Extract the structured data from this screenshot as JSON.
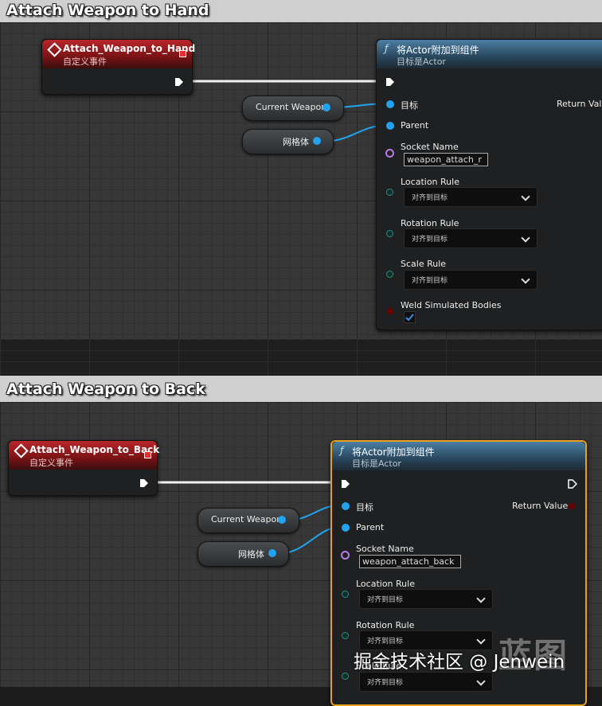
{
  "top": {
    "comment_title": "Attach Weapon to Hand",
    "event": {
      "title": "Attach_Weapon_to_Hand",
      "subtitle": "自定义事件"
    },
    "function": {
      "f_glyph": "ƒ",
      "title": "将Actor附加到组件",
      "subtitle": "目标是Actor",
      "return_label": "Return Valu",
      "pins": {
        "target": "目标",
        "parent": "Parent",
        "socket_name": "Socket Name",
        "socket_value": "weapon_attach_r",
        "location_rule": "Location Rule",
        "location_value": "对齐到目标",
        "rotation_rule": "Rotation Rule",
        "rotation_value": "对齐到目标",
        "scale_rule": "Scale Rule",
        "scale_value": "对齐到目标",
        "weld": "Weld Simulated Bodies"
      }
    },
    "vars": {
      "current_weapon": "Current Weapon",
      "mesh": "网格体"
    }
  },
  "bottom": {
    "comment_title": "Attach Weapon to Back",
    "event": {
      "title": "Attach_Weapon_to_Back",
      "subtitle": "自定义事件"
    },
    "function": {
      "f_glyph": "ƒ",
      "title": "将Actor附加到组件",
      "subtitle": "目标是Actor",
      "return_label": "Return Value",
      "pins": {
        "target": "目标",
        "parent": "Parent",
        "socket_name": "Socket Name",
        "socket_value": "weapon_attach_back",
        "location_rule": "Location Rule",
        "location_value": "对齐到目标",
        "rotation_rule": "Rotation Rule",
        "rotation_value": "对齐到目标",
        "scale_rule": "Scale Rule",
        "scale_value": "对齐到目标"
      }
    },
    "vars": {
      "current_weapon": "Current Weapon",
      "mesh": "网格体"
    }
  },
  "watermark": {
    "big": "蓝图",
    "text": "掘金技术社区 @ Jenwein"
  },
  "colors": {
    "event_red": "#b8262b",
    "function_blue": "#4c7fa3",
    "object_pin": "#22a3ef",
    "selection": "#e8a11a"
  }
}
